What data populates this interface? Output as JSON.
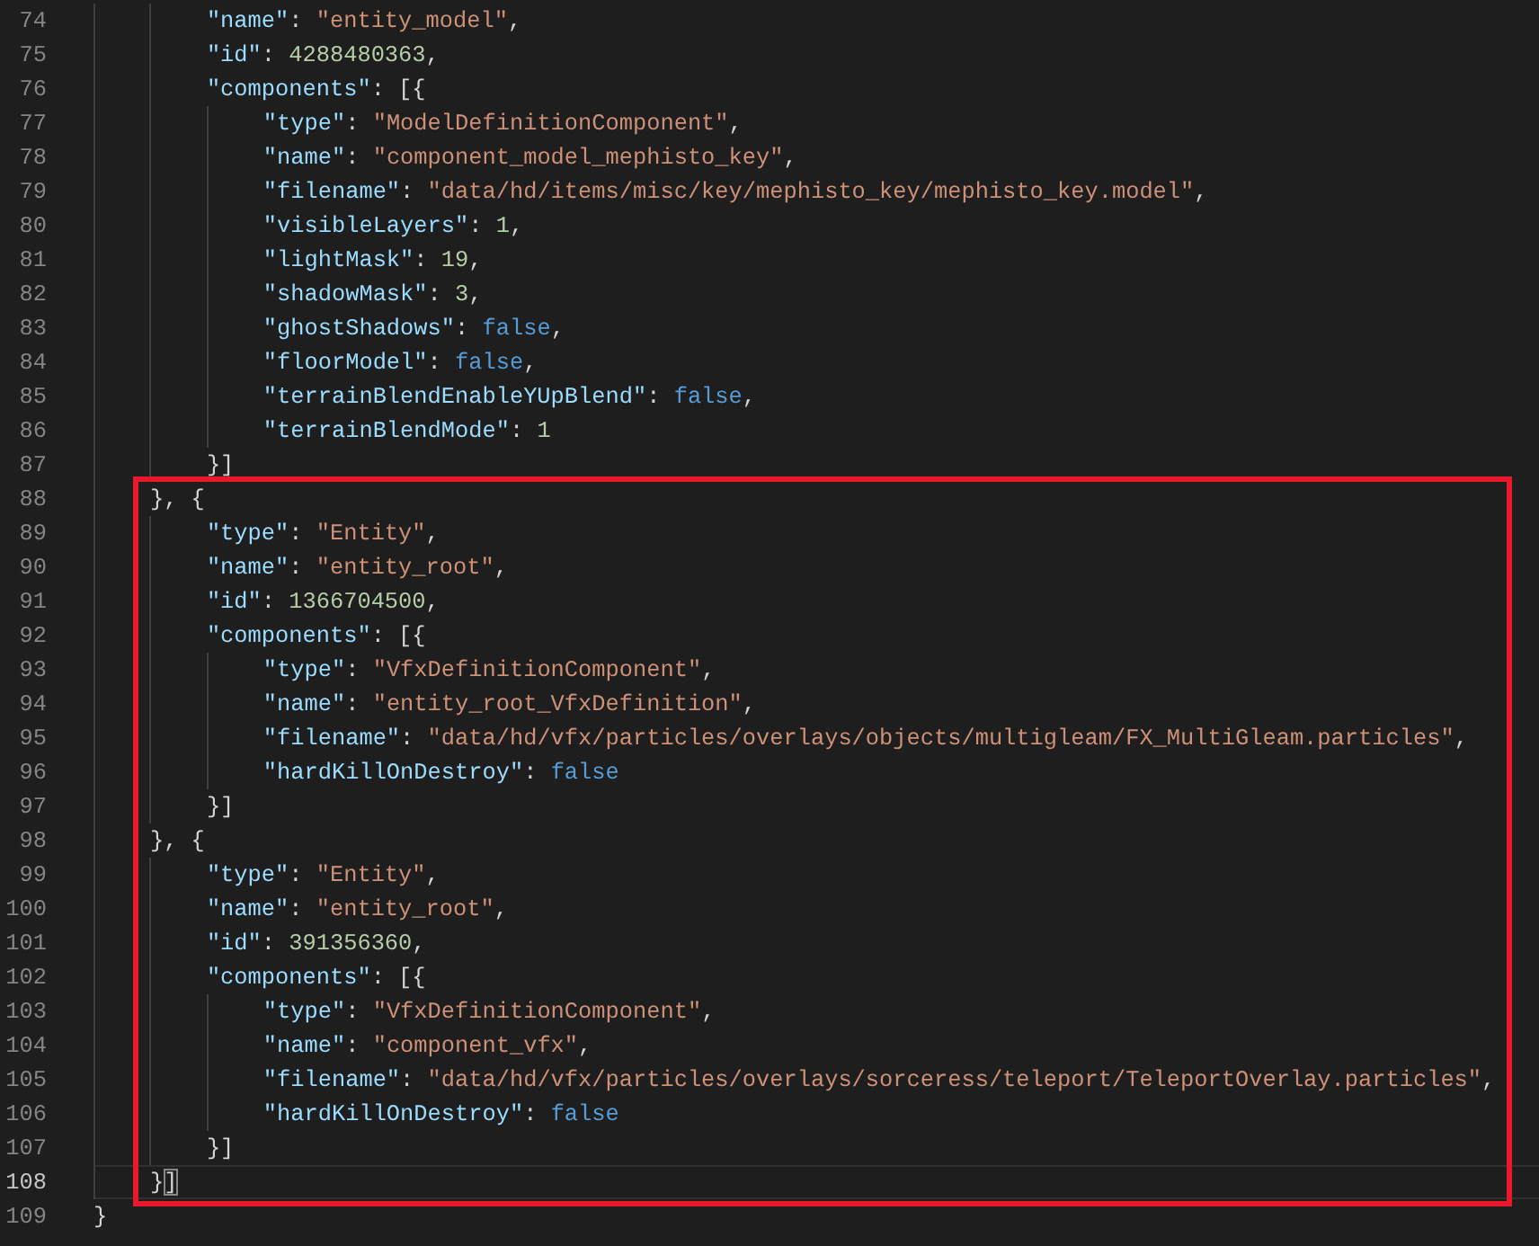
{
  "editor": {
    "blocks": [
      {
        "highlighted": false,
        "lines": [
          {
            "number": "74",
            "current": false,
            "tokens": [
              {
                "kind": "key",
                "t": "        \"name\""
              },
              {
                "kind": "p",
                "t": ": "
              },
              {
                "kind": "str",
                "t": "\"entity_model\""
              },
              {
                "kind": "p",
                "t": ","
              }
            ]
          },
          {
            "number": "75",
            "current": false,
            "tokens": [
              {
                "kind": "key",
                "t": "        \"id\""
              },
              {
                "kind": "p",
                "t": ": "
              },
              {
                "kind": "num",
                "t": "4288480363"
              },
              {
                "kind": "p",
                "t": ","
              }
            ]
          },
          {
            "number": "76",
            "current": false,
            "tokens": [
              {
                "kind": "key",
                "t": "        \"components\""
              },
              {
                "kind": "p",
                "t": ": [{"
              }
            ]
          },
          {
            "number": "77",
            "current": false,
            "tokens": [
              {
                "kind": "key",
                "t": "            \"type\""
              },
              {
                "kind": "p",
                "t": ": "
              },
              {
                "kind": "str",
                "t": "\"ModelDefinitionComponent\""
              },
              {
                "kind": "p",
                "t": ","
              }
            ]
          },
          {
            "number": "78",
            "current": false,
            "tokens": [
              {
                "kind": "key",
                "t": "            \"name\""
              },
              {
                "kind": "p",
                "t": ": "
              },
              {
                "kind": "str",
                "t": "\"component_model_mephisto_key\""
              },
              {
                "kind": "p",
                "t": ","
              }
            ]
          },
          {
            "number": "79",
            "current": false,
            "tokens": [
              {
                "kind": "key",
                "t": "            \"filename\""
              },
              {
                "kind": "p",
                "t": ": "
              },
              {
                "kind": "str",
                "t": "\"data/hd/items/misc/key/mephisto_key/mephisto_key.model\""
              },
              {
                "kind": "p",
                "t": ","
              }
            ]
          },
          {
            "number": "80",
            "current": false,
            "tokens": [
              {
                "kind": "key",
                "t": "            \"visibleLayers\""
              },
              {
                "kind": "p",
                "t": ": "
              },
              {
                "kind": "num",
                "t": "1"
              },
              {
                "kind": "p",
                "t": ","
              }
            ]
          },
          {
            "number": "81",
            "current": false,
            "tokens": [
              {
                "kind": "key",
                "t": "            \"lightMask\""
              },
              {
                "kind": "p",
                "t": ": "
              },
              {
                "kind": "num",
                "t": "19"
              },
              {
                "kind": "p",
                "t": ","
              }
            ]
          },
          {
            "number": "82",
            "current": false,
            "tokens": [
              {
                "kind": "key",
                "t": "            \"shadowMask\""
              },
              {
                "kind": "p",
                "t": ": "
              },
              {
                "kind": "num",
                "t": "3"
              },
              {
                "kind": "p",
                "t": ","
              }
            ]
          },
          {
            "number": "83",
            "current": false,
            "tokens": [
              {
                "kind": "key",
                "t": "            \"ghostShadows\""
              },
              {
                "kind": "p",
                "t": ": "
              },
              {
                "kind": "bool",
                "t": "false"
              },
              {
                "kind": "p",
                "t": ","
              }
            ]
          },
          {
            "number": "84",
            "current": false,
            "tokens": [
              {
                "kind": "key",
                "t": "            \"floorModel\""
              },
              {
                "kind": "p",
                "t": ": "
              },
              {
                "kind": "bool",
                "t": "false"
              },
              {
                "kind": "p",
                "t": ","
              }
            ]
          },
          {
            "number": "85",
            "current": false,
            "tokens": [
              {
                "kind": "key",
                "t": "            \"terrainBlendEnableYUpBlend\""
              },
              {
                "kind": "p",
                "t": ": "
              },
              {
                "kind": "bool",
                "t": "false"
              },
              {
                "kind": "p",
                "t": ","
              }
            ]
          },
          {
            "number": "86",
            "current": false,
            "tokens": [
              {
                "kind": "key",
                "t": "            \"terrainBlendMode\""
              },
              {
                "kind": "p",
                "t": ": "
              },
              {
                "kind": "num",
                "t": "1"
              }
            ]
          },
          {
            "number": "87",
            "current": false,
            "tokens": [
              {
                "kind": "p",
                "t": "        }]"
              }
            ]
          }
        ]
      },
      {
        "highlighted": true,
        "lines": [
          {
            "number": "88",
            "current": false,
            "tokens": [
              {
                "kind": "p",
                "t": "    }, {"
              }
            ]
          },
          {
            "number": "89",
            "current": false,
            "tokens": [
              {
                "kind": "key",
                "t": "        \"type\""
              },
              {
                "kind": "p",
                "t": ": "
              },
              {
                "kind": "str",
                "t": "\"Entity\""
              },
              {
                "kind": "p",
                "t": ","
              }
            ]
          },
          {
            "number": "90",
            "current": false,
            "tokens": [
              {
                "kind": "key",
                "t": "        \"name\""
              },
              {
                "kind": "p",
                "t": ": "
              },
              {
                "kind": "str",
                "t": "\"entity_root\""
              },
              {
                "kind": "p",
                "t": ","
              }
            ]
          },
          {
            "number": "91",
            "current": false,
            "tokens": [
              {
                "kind": "key",
                "t": "        \"id\""
              },
              {
                "kind": "p",
                "t": ": "
              },
              {
                "kind": "num",
                "t": "1366704500"
              },
              {
                "kind": "p",
                "t": ","
              }
            ]
          },
          {
            "number": "92",
            "current": false,
            "tokens": [
              {
                "kind": "key",
                "t": "        \"components\""
              },
              {
                "kind": "p",
                "t": ": [{"
              }
            ]
          },
          {
            "number": "93",
            "current": false,
            "tokens": [
              {
                "kind": "key",
                "t": "            \"type\""
              },
              {
                "kind": "p",
                "t": ": "
              },
              {
                "kind": "str",
                "t": "\"VfxDefinitionComponent\""
              },
              {
                "kind": "p",
                "t": ","
              }
            ]
          },
          {
            "number": "94",
            "current": false,
            "tokens": [
              {
                "kind": "key",
                "t": "            \"name\""
              },
              {
                "kind": "p",
                "t": ": "
              },
              {
                "kind": "str",
                "t": "\"entity_root_VfxDefinition\""
              },
              {
                "kind": "p",
                "t": ","
              }
            ]
          },
          {
            "number": "95",
            "current": false,
            "tokens": [
              {
                "kind": "key",
                "t": "            \"filename\""
              },
              {
                "kind": "p",
                "t": ": "
              },
              {
                "kind": "str",
                "t": "\"data/hd/vfx/particles/overlays/objects/multigleam/FX_MultiGleam.particles\""
              },
              {
                "kind": "p",
                "t": ","
              }
            ]
          },
          {
            "number": "96",
            "current": false,
            "tokens": [
              {
                "kind": "key",
                "t": "            \"hardKillOnDestroy\""
              },
              {
                "kind": "p",
                "t": ": "
              },
              {
                "kind": "bool",
                "t": "false"
              }
            ]
          },
          {
            "number": "97",
            "current": false,
            "tokens": [
              {
                "kind": "p",
                "t": "        }]"
              }
            ]
          },
          {
            "number": "98",
            "current": false,
            "tokens": [
              {
                "kind": "p",
                "t": "    }, {"
              }
            ]
          },
          {
            "number": "99",
            "current": false,
            "tokens": [
              {
                "kind": "key",
                "t": "        \"type\""
              },
              {
                "kind": "p",
                "t": ": "
              },
              {
                "kind": "str",
                "t": "\"Entity\""
              },
              {
                "kind": "p",
                "t": ","
              }
            ]
          },
          {
            "number": "100",
            "current": false,
            "tokens": [
              {
                "kind": "key",
                "t": "        \"name\""
              },
              {
                "kind": "p",
                "t": ": "
              },
              {
                "kind": "str",
                "t": "\"entity_root\""
              },
              {
                "kind": "p",
                "t": ","
              }
            ]
          },
          {
            "number": "101",
            "current": false,
            "tokens": [
              {
                "kind": "key",
                "t": "        \"id\""
              },
              {
                "kind": "p",
                "t": ": "
              },
              {
                "kind": "num",
                "t": "391356360"
              },
              {
                "kind": "p",
                "t": ","
              }
            ]
          },
          {
            "number": "102",
            "current": false,
            "tokens": [
              {
                "kind": "key",
                "t": "        \"components\""
              },
              {
                "kind": "p",
                "t": ": [{"
              }
            ]
          },
          {
            "number": "103",
            "current": false,
            "tokens": [
              {
                "kind": "key",
                "t": "            \"type\""
              },
              {
                "kind": "p",
                "t": ": "
              },
              {
                "kind": "str",
                "t": "\"VfxDefinitionComponent\""
              },
              {
                "kind": "p",
                "t": ","
              }
            ]
          },
          {
            "number": "104",
            "current": false,
            "tokens": [
              {
                "kind": "key",
                "t": "            \"name\""
              },
              {
                "kind": "p",
                "t": ": "
              },
              {
                "kind": "str",
                "t": "\"component_vfx\""
              },
              {
                "kind": "p",
                "t": ","
              }
            ]
          },
          {
            "number": "105",
            "current": false,
            "tokens": [
              {
                "kind": "key",
                "t": "            \"filename\""
              },
              {
                "kind": "p",
                "t": ": "
              },
              {
                "kind": "str",
                "t": "\"data/hd/vfx/particles/overlays/sorceress/teleport/TeleportOverlay.particles\""
              },
              {
                "kind": "p",
                "t": ","
              }
            ]
          },
          {
            "number": "106",
            "current": false,
            "tokens": [
              {
                "kind": "key",
                "t": "            \"hardKillOnDestroy\""
              },
              {
                "kind": "p",
                "t": ": "
              },
              {
                "kind": "bool",
                "t": "false"
              }
            ]
          },
          {
            "number": "107",
            "current": false,
            "tokens": [
              {
                "kind": "p",
                "t": "        }]"
              }
            ]
          },
          {
            "number": "108",
            "current": true,
            "tokens": [
              {
                "kind": "p",
                "t": "    }"
              },
              {
                "kind": "match",
                "t": "]"
              }
            ]
          }
        ]
      },
      {
        "highlighted": false,
        "lines": [
          {
            "number": "109",
            "current": false,
            "tokens": [
              {
                "kind": "p",
                "t": "}"
              }
            ]
          }
        ]
      }
    ]
  }
}
